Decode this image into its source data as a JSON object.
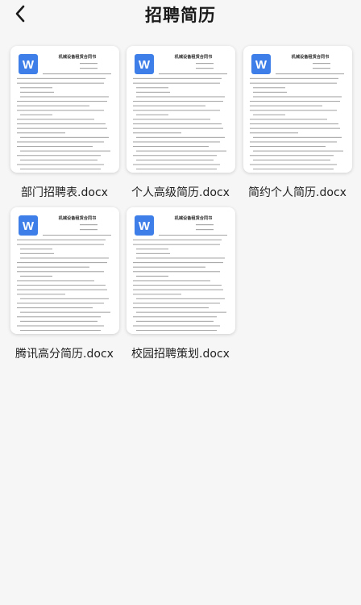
{
  "header": {
    "title": "招聘简历",
    "back_icon": "chevron-left-icon"
  },
  "doc_preview": {
    "icon": "word-doc-icon",
    "icon_letter": "W",
    "icon_color": "#3d7ee8",
    "heading": "机械设备租赁合同书"
  },
  "files": [
    {
      "name": "部门招聘表.docx"
    },
    {
      "name": "个人高级简历.docx"
    },
    {
      "name": "简约个人简历.docx"
    },
    {
      "name": "腾讯高分简历.docx"
    },
    {
      "name": "校园招聘策划.docx"
    }
  ]
}
